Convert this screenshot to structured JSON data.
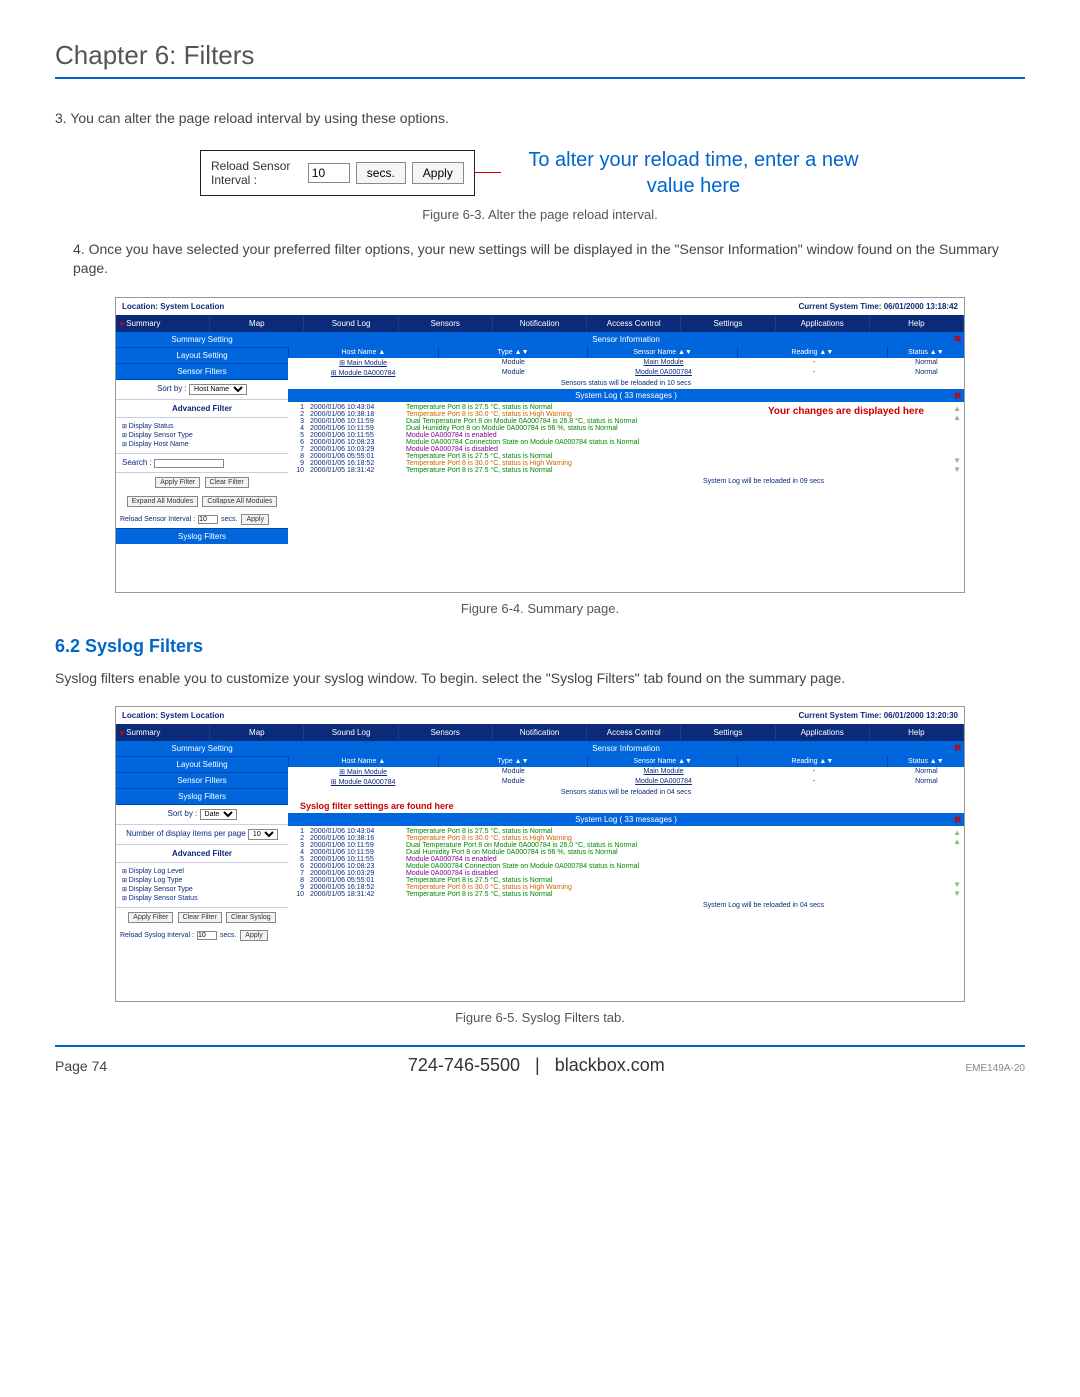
{
  "chapter_title": "Chapter 6: Filters",
  "step3_text": "3. You can alter the page reload interval by using these options.",
  "reload_ui": {
    "label": "Reload Sensor Interval :",
    "value": "10",
    "secs_label": "secs.",
    "apply": "Apply"
  },
  "reload_callout": "To alter your reload time, enter a new value here",
  "fig63_caption": "Figure 6-3. Alter the page reload interval.",
  "step4_text": "4. Once you have selected your preferred filter options, your new settings will be displayed in the \"Sensor Information\" window found on the Summary page.",
  "fig64_caption": "Figure 6-4. Summary page.",
  "section_heading": "6.2 Syslog Filters",
  "section_intro": "Syslog filters enable you to customize your syslog window. To begin. select the \"Syslog Filters\" tab found on the summary page.",
  "fig65_caption": "Figure 6-5. Syslog Filters tab.",
  "footer": {
    "page": "Page 74",
    "phone": "724-746-5500",
    "divider": "|",
    "site": "blackbox.com",
    "doc": "EME149A-20"
  },
  "sc_common": {
    "location": "Location: System Location",
    "time_label": "Current System Time:",
    "tabs": [
      "Summary",
      "Map",
      "Sound Log",
      "Sensors",
      "Notification",
      "Access Control",
      "Settings",
      "Applications",
      "Help"
    ],
    "sensor_info": "Sensor Information",
    "cols": {
      "host": "Host Name ▲",
      "type": "Type ▲▼",
      "sensor": "Sensor Name ▲▼",
      "reading": "Reading ▲▼",
      "status": "Status ▲▼"
    },
    "sensor_rows": [
      {
        "host": "Main Module",
        "type": "Module",
        "sensor": "Main Module",
        "reading": "-",
        "status": "Normal"
      },
      {
        "host": "Module 0A000784",
        "type": "Module",
        "sensor": "Module 0A000784",
        "reading": "-",
        "status": "Normal"
      }
    ],
    "syslog_bar": "System Log ( 33 messages )",
    "log_footer": "System Log will be reloaded in"
  },
  "sc4": {
    "time": "06/01/2000 13:18:42",
    "left": {
      "summary_setting": "Summary Setting",
      "layout_setting": "Layout Setting",
      "sensor_filters": "Sensor Filters",
      "sort_label": "Sort by :",
      "sort_value": "Host Name",
      "advanced": "Advanced Filter",
      "items": [
        "Display Status",
        "Display Sensor Type",
        "Display Host Name"
      ],
      "search_label": "Search :",
      "apply_filter": "Apply Filter",
      "clear_filter": "Clear Filter",
      "expand_all": "Expand All Modules",
      "collapse_all": "Collapse All Modules",
      "reload_label": "Reload Sensor Interval :",
      "reload_value": "10",
      "secs": "secs.",
      "apply": "Apply",
      "syslog_tab": "Syslog Filters"
    },
    "sensor_status_note": "Sensors status will be reloaded in 10 secs",
    "annotation": "Your changes are displayed here",
    "logs": [
      {
        "n": "1",
        "ts": "2000/01/06 10:43:04",
        "msg": "Temperature Port 8 is 27.5 °C, status is Normal",
        "cls": "log-green"
      },
      {
        "n": "2",
        "ts": "2000/01/06 10:38:18",
        "msg": "Temperature Port 8 is 30.0 °C, status is High Warning",
        "cls": "log-orange"
      },
      {
        "n": "3",
        "ts": "2000/01/06 10:11:59",
        "msg": "Dual Temperature Port 8 on Module 0A000784 is 26.8 °C, status is Normal",
        "cls": "log-green"
      },
      {
        "n": "4",
        "ts": "2000/01/06 10:11:59",
        "msg": "Dual Humidity Port 8 on Module 0A000784 is 56 %, status is Normal",
        "cls": "log-green"
      },
      {
        "n": "5",
        "ts": "2000/01/06 10:11:55",
        "msg": "Module 0A000784 is enabled",
        "cls": "log-purple"
      },
      {
        "n": "6",
        "ts": "2000/01/06 10:08:23",
        "msg": "Module 0A000784 Connection State on Module 0A000784 status is Normal",
        "cls": "log-green"
      },
      {
        "n": "7",
        "ts": "2000/01/06 10:03:29",
        "msg": "Module 0A000784 is disabled",
        "cls": "log-purple"
      },
      {
        "n": "8",
        "ts": "2000/01/06 05:55:01",
        "msg": "Temperature Port 8 is 27.5 °C, status is Normal",
        "cls": "log-green"
      },
      {
        "n": "9",
        "ts": "2000/01/05 16:18:52",
        "msg": "Temperature Port 8 is 30.0 °C, status is High Warning",
        "cls": "log-orange"
      },
      {
        "n": "10",
        "ts": "2000/01/05 18:31:42",
        "msg": "Temperature Port 8 is 27.5 °C, status is Normal",
        "cls": "log-green"
      }
    ],
    "log_reload_secs": "09 secs"
  },
  "sc5": {
    "time": "06/01/2000 13:20:30",
    "left": {
      "summary_setting": "Summary Setting",
      "layout_setting": "Layout Setting",
      "sensor_filters": "Sensor Filters",
      "syslog_filters": "Syslog Filters",
      "sort_label": "Sort by :",
      "sort_value": "Date",
      "num_label": "Number of display items per page",
      "num_value": "10",
      "advanced": "Advanced Filter",
      "items": [
        "Display Log Level",
        "Display Log Type",
        "Display Sensor Type",
        "Display Sensor Status"
      ],
      "apply_filter": "Apply Filter",
      "clear_filter": "Clear Filter",
      "clear_syslog": "Clear Syslog",
      "reload_label": "Reload Syslog Interval :",
      "reload_value": "10",
      "secs": "secs.",
      "apply": "Apply"
    },
    "sensor_status_note": "Sensors status will be reloaded in 04 secs",
    "callout": "Syslog filter settings are found here",
    "logs": [
      {
        "n": "1",
        "ts": "2000/01/06 10:43:04",
        "msg": "Temperature Port 8 is 27.5 °C, status is Normal",
        "cls": "log-green"
      },
      {
        "n": "2",
        "ts": "2000/01/06 10:38:16",
        "msg": "Temperature Port 8 is 30.0 °C, status is High Warning",
        "cls": "log-orange"
      },
      {
        "n": "3",
        "ts": "2000/01/06 10:11:59",
        "msg": "Dual Temperature Port 8 on Module 0A000784 is 26.0 °C, status is Normal",
        "cls": "log-green"
      },
      {
        "n": "4",
        "ts": "2000/01/06 10:11:59",
        "msg": "Dual Humidity Port 8 on Module 0A000784 is 56 %, status is Normal",
        "cls": "log-green"
      },
      {
        "n": "5",
        "ts": "2000/01/06 10:11:55",
        "msg": "Module 0A000784 is enabled",
        "cls": "log-purple"
      },
      {
        "n": "6",
        "ts": "2000/01/06 10:08:23",
        "msg": "Module 0A000784 Connection State on Module 0A000784 status is Normal",
        "cls": "log-green"
      },
      {
        "n": "7",
        "ts": "2000/01/06 10:03:29",
        "msg": "Module 0A000784 is disabled",
        "cls": "log-purple"
      },
      {
        "n": "8",
        "ts": "2000/01/06 05:55:01",
        "msg": "Temperature Port 8 is 27.5 °C, status is Normal",
        "cls": "log-green"
      },
      {
        "n": "9",
        "ts": "2000/01/05 16:18:52",
        "msg": "Temperature Port 8 is 30.0 °C, status is High Warning",
        "cls": "log-orange"
      },
      {
        "n": "10",
        "ts": "2000/01/05 18:31:42",
        "msg": "Temperature Port 8 is 27.5 °C, status is Normal",
        "cls": "log-green"
      }
    ],
    "log_reload_secs": "04 secs"
  }
}
